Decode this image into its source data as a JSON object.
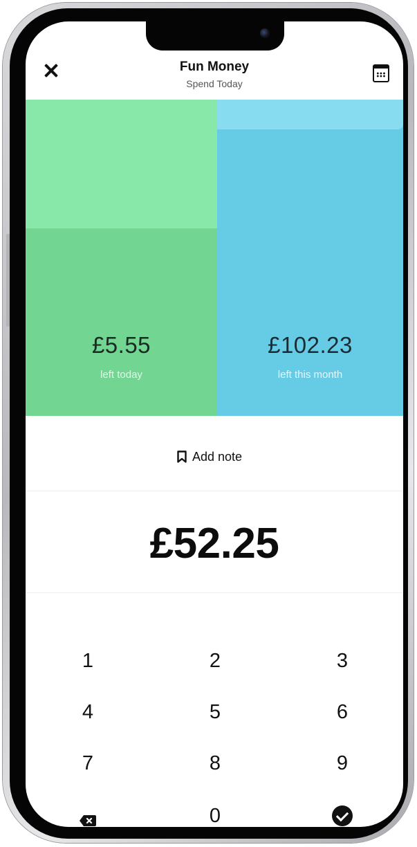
{
  "header": {
    "title": "Fun Money",
    "subtitle": "Spend Today",
    "close_icon": "close-icon",
    "calendar_icon": "calendar-icon"
  },
  "panels": {
    "today": {
      "amount": "£5.55",
      "label": "left today",
      "color": "#72d592",
      "fill_color": "#88e8aa"
    },
    "month": {
      "amount": "£102.23",
      "label": "left this month",
      "color": "#66cce6",
      "fill_color": "#88dcef"
    }
  },
  "note": {
    "label": "Add note",
    "icon": "bookmark-icon"
  },
  "entry": {
    "amount": "£52.25"
  },
  "keypad": {
    "keys": [
      "1",
      "2",
      "3",
      "4",
      "5",
      "6",
      "7",
      "8",
      "9",
      "0"
    ],
    "backspace_icon": "backspace-icon",
    "confirm_icon": "check-circle-icon"
  }
}
